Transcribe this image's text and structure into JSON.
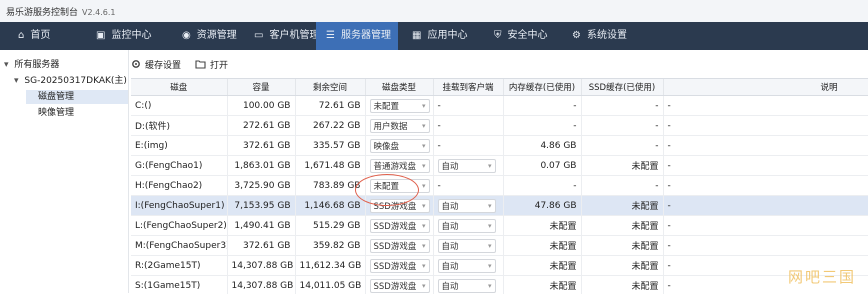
{
  "app": {
    "title": "易乐游服务控制台",
    "version": "V2.4.6.1"
  },
  "nav": [
    {
      "label": "首页",
      "icon": "home-icon",
      "active": false
    },
    {
      "label": "监控中心",
      "icon": "monitor-icon",
      "active": false
    },
    {
      "label": "资源管理",
      "icon": "resource-icon",
      "active": false
    },
    {
      "label": "客户机管理",
      "icon": "client-icon",
      "active": false
    },
    {
      "label": "服务器管理",
      "icon": "server-icon",
      "active": true
    },
    {
      "label": "应用中心",
      "icon": "app-icon",
      "active": false
    },
    {
      "label": "安全中心",
      "icon": "shield-icon",
      "active": false
    },
    {
      "label": "系统设置",
      "icon": "gear-icon",
      "active": false
    }
  ],
  "sidebar": {
    "root": "所有服务器",
    "server": "SG-20250317DKAK(主)",
    "items": [
      "磁盘管理",
      "映像管理"
    ]
  },
  "toolbar": {
    "cache_label": "缓存设置",
    "open_label": "打开"
  },
  "table": {
    "headers": [
      "磁盘",
      "容量",
      "剩余空间",
      "磁盘类型",
      "挂载到客户端",
      "内存缓存(已使用)",
      "SSD缓存(已使用)",
      "说明"
    ],
    "rows": [
      {
        "disk": "C:()",
        "capacity": "100.00 GB",
        "free": "72.61 GB",
        "type": "未配置",
        "type_select": true,
        "mount": "-",
        "mount_select": false,
        "mem": "-",
        "ssd": "-",
        "note": "-"
      },
      {
        "disk": "D:(软件)",
        "capacity": "272.61 GB",
        "free": "267.22 GB",
        "type": "用户数据",
        "type_select": true,
        "mount": "-",
        "mount_select": false,
        "mem": "-",
        "ssd": "-",
        "note": "-"
      },
      {
        "disk": "E:(img)",
        "capacity": "372.61 GB",
        "free": "335.57 GB",
        "type": "映像盘",
        "type_select": true,
        "mount": "-",
        "mount_select": false,
        "mem": "4.86 GB",
        "ssd": "-",
        "note": "-"
      },
      {
        "disk": "G:(FengChao1)",
        "capacity": "1,863.01 GB",
        "free": "1,671.48 GB",
        "type": "普通游戏盘",
        "type_select": true,
        "mount": "自动",
        "mount_select": true,
        "mem": "0.07 GB",
        "ssd": "未配置",
        "note": "-"
      },
      {
        "disk": "H:(FengChao2)",
        "capacity": "3,725.90 GB",
        "free": "783.89 GB",
        "type": "未配置",
        "type_select": true,
        "mount": "-",
        "mount_select": false,
        "mem": "-",
        "ssd": "-",
        "note": "-"
      },
      {
        "disk": "I:(FengChaoSuper1)",
        "capacity": "7,153.95 GB",
        "free": "1,146.68 GB",
        "type": "SSD游戏盘",
        "type_select": true,
        "mount": "自动",
        "mount_select": true,
        "mem": "47.86 GB",
        "ssd": "未配置",
        "note": "-",
        "selected": true
      },
      {
        "disk": "L:(FengChaoSuper2)",
        "capacity": "1,490.41 GB",
        "free": "515.29 GB",
        "type": "SSD游戏盘",
        "type_select": true,
        "mount": "自动",
        "mount_select": true,
        "mem": "未配置",
        "ssd": "未配置",
        "note": "-"
      },
      {
        "disk": "M:(FengChaoSuper3)",
        "capacity": "372.61 GB",
        "free": "359.82 GB",
        "type": "SSD游戏盘",
        "type_select": true,
        "mount": "自动",
        "mount_select": true,
        "mem": "未配置",
        "ssd": "未配置",
        "note": "-"
      },
      {
        "disk": "R:(2Game15T)",
        "capacity": "14,307.88 GB",
        "free": "11,612.34 GB",
        "type": "SSD游戏盘",
        "type_select": true,
        "mount": "自动",
        "mount_select": true,
        "mem": "未配置",
        "ssd": "未配置",
        "note": "-"
      },
      {
        "disk": "S:(1Game15T)",
        "capacity": "14,307.88 GB",
        "free": "14,011.05 GB",
        "type": "SSD游戏盘",
        "type_select": true,
        "mount": "自动",
        "mount_select": true,
        "mem": "未配置",
        "ssd": "未配置",
        "note": "-"
      }
    ]
  },
  "watermark": "网吧三国",
  "colors": {
    "navbar": "#2b3a4f",
    "nav_active": "#3d6fb6",
    "selected_row": "#dde6f4",
    "annotation": "#e0604c",
    "watermark": "#f0c060"
  }
}
